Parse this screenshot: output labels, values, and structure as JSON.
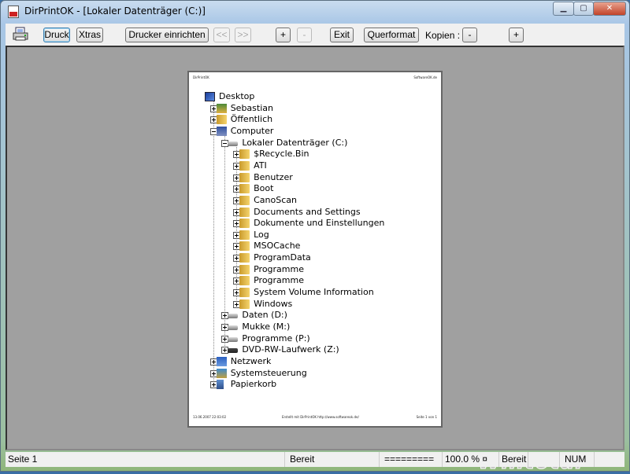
{
  "window": {
    "title": "DirPrintOK - [Lokaler Datenträger (C:)]"
  },
  "toolbar": {
    "druck": "Druck",
    "xtras": "Xtras",
    "drucker": "Drucker einrichten",
    "prev": "<<",
    "next": ">>",
    "zoom_in": "+",
    "zoom_out": "-",
    "exit": "Exit",
    "querformat": "Querformat",
    "kopien_label": "Kopien :",
    "kopien_minus": "-",
    "kopien_plus": "+"
  },
  "page": {
    "header_left": "DirPrintOK",
    "header_right": "SoftwareOK.de",
    "footer_left": "13.06.2007 22:03:02",
    "footer_center": "Erstellt mit DirPrintOK http://www.softwareok.de/",
    "footer_right": "Seite 1 von 1",
    "tree": [
      {
        "label": "Desktop",
        "level": 0,
        "icon": "desktop",
        "exp": ""
      },
      {
        "label": "Sebastian",
        "level": 1,
        "icon": "user",
        "exp": "plus"
      },
      {
        "label": "Öffentlich",
        "level": 1,
        "icon": "folder",
        "exp": "plus"
      },
      {
        "label": "Computer",
        "level": 1,
        "icon": "computer",
        "exp": "minus"
      },
      {
        "label": "Lokaler Datenträger (C:)",
        "level": 2,
        "icon": "drive",
        "exp": "minus"
      },
      {
        "label": "$Recycle.Bin",
        "level": 3,
        "icon": "folder",
        "exp": "plus"
      },
      {
        "label": "ATI",
        "level": 3,
        "icon": "folder",
        "exp": "plus"
      },
      {
        "label": "Benutzer",
        "level": 3,
        "icon": "folder",
        "exp": "plus"
      },
      {
        "label": "Boot",
        "level": 3,
        "icon": "folder",
        "exp": "plus"
      },
      {
        "label": "CanoScan",
        "level": 3,
        "icon": "folder",
        "exp": "plus"
      },
      {
        "label": "Documents and Settings",
        "level": 3,
        "icon": "folder",
        "exp": "plus"
      },
      {
        "label": "Dokumente und Einstellungen",
        "level": 3,
        "icon": "folder",
        "exp": "plus"
      },
      {
        "label": "Log",
        "level": 3,
        "icon": "folder",
        "exp": "plus"
      },
      {
        "label": "MSOCache",
        "level": 3,
        "icon": "folder",
        "exp": "plus"
      },
      {
        "label": "ProgramData",
        "level": 3,
        "icon": "folder",
        "exp": "plus"
      },
      {
        "label": "Programme",
        "level": 3,
        "icon": "folder",
        "exp": "plus"
      },
      {
        "label": "Programme",
        "level": 3,
        "icon": "folder",
        "exp": "plus"
      },
      {
        "label": "System Volume Information",
        "level": 3,
        "icon": "folder",
        "exp": "plus"
      },
      {
        "label": "Windows",
        "level": 3,
        "icon": "folder",
        "exp": "plus"
      },
      {
        "label": "Daten (D:)",
        "level": 2,
        "icon": "drive",
        "exp": "plus"
      },
      {
        "label": "Mukke (M:)",
        "level": 2,
        "icon": "drive",
        "exp": "plus"
      },
      {
        "label": "Programme (P:)",
        "level": 2,
        "icon": "drive",
        "exp": "plus"
      },
      {
        "label": "DVD-RW-Laufwerk (Z:)",
        "level": 2,
        "icon": "dvd",
        "exp": "plus"
      },
      {
        "label": "Netzwerk",
        "level": 1,
        "icon": "net",
        "exp": "plus"
      },
      {
        "label": "Systemsteuerung",
        "level": 1,
        "icon": "panel",
        "exp": "plus"
      },
      {
        "label": "Papierkorb",
        "level": 1,
        "icon": "trash",
        "exp": "plus"
      }
    ]
  },
  "watermark": "Wintotal",
  "status": {
    "page": "Seite 1",
    "state": "Bereit",
    "progress": "=========",
    "zoom": "100.0 % ¤",
    "state2": "Bereit",
    "num": "NUM"
  }
}
